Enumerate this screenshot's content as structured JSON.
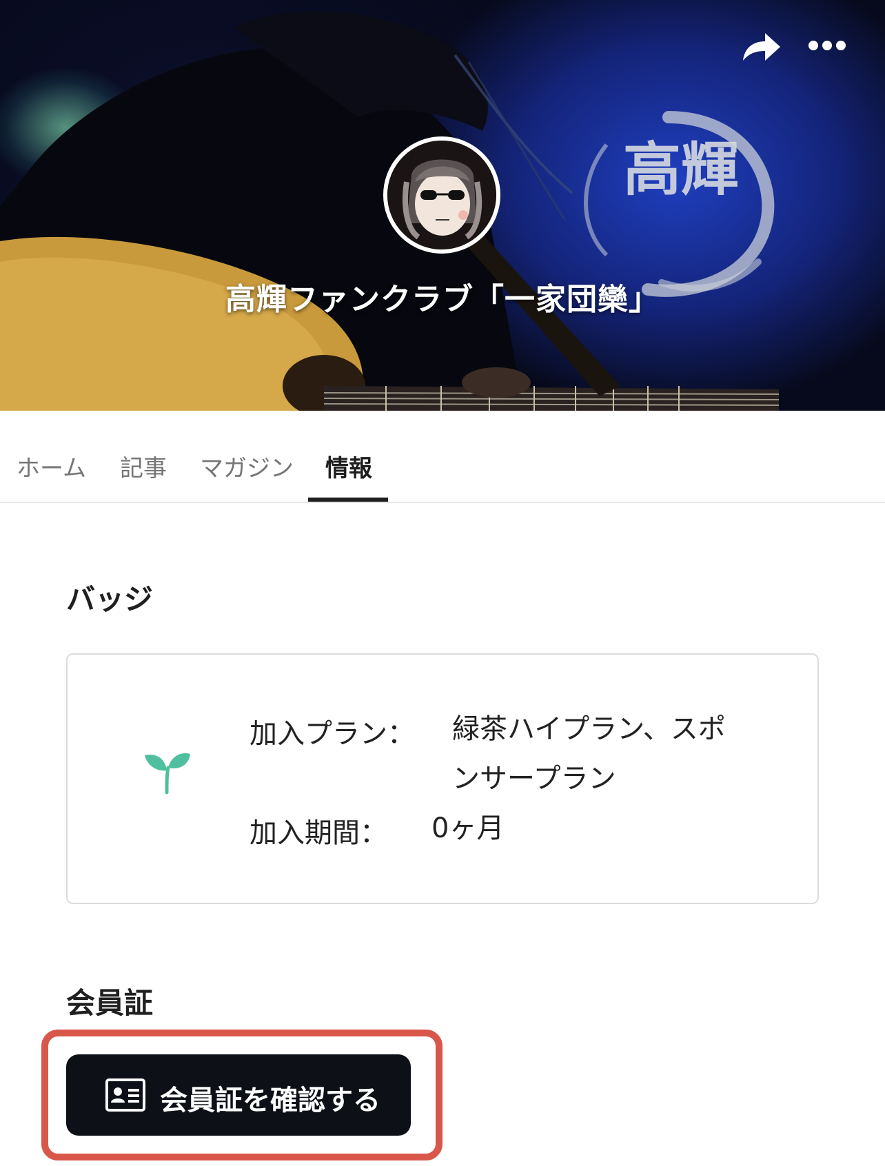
{
  "header": {
    "title": "高輝ファンクラブ「一家団欒」",
    "calligraphy_text": "高輝",
    "share_icon": "share-arrow-icon",
    "more_icon": "more-dots-icon"
  },
  "tabs": [
    {
      "label": "ホーム",
      "active": false
    },
    {
      "label": "記事",
      "active": false
    },
    {
      "label": "マガジン",
      "active": false
    },
    {
      "label": "情報",
      "active": true
    }
  ],
  "badge": {
    "section_title": "バッジ",
    "icon": "sprout-icon",
    "icon_color": "#4fbf9f",
    "plan_label": "加入プラン：",
    "plan_value_line1": "緑茶ハイプラン、スポ",
    "plan_value_line2": "ンサープラン",
    "period_label": "加入期間：",
    "period_value": "0ヶ月"
  },
  "membership": {
    "section_title": "会員証",
    "button_label": "会員証を確認する",
    "button_icon": "id-card-icon",
    "highlight_color": "#d9574a"
  }
}
